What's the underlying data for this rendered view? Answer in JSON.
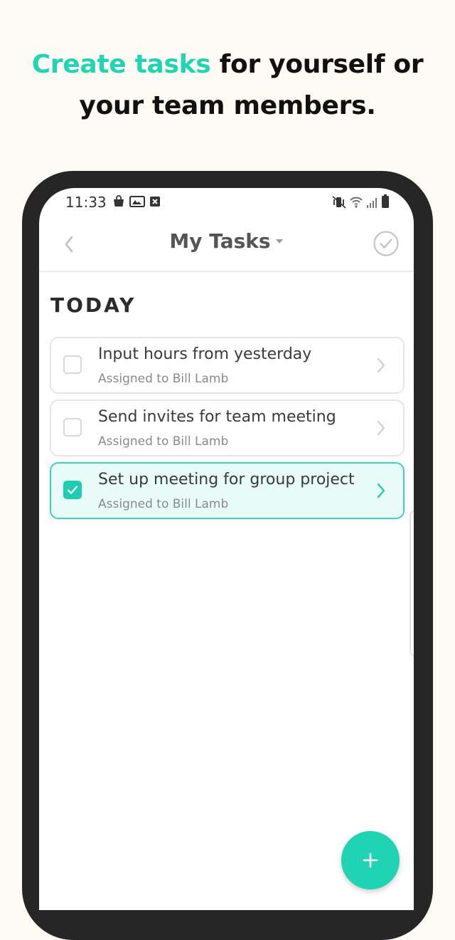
{
  "headline": {
    "accent": "Create tasks",
    "rest": " for yourself or your team members."
  },
  "status_bar": {
    "time": "11:33",
    "left_icons": [
      "shopping-bag-icon",
      "gallery-icon",
      "close-box-icon"
    ],
    "right_icons": [
      "vibrate-mute-icon",
      "wifi-icon",
      "signal-icon",
      "battery-icon"
    ]
  },
  "nav": {
    "title": "My Tasks",
    "back_icon": "chevron-left-icon",
    "title_icon": "caret-down-icon",
    "complete_icon": "check-circle-icon"
  },
  "section": {
    "title": "TODAY"
  },
  "tasks": [
    {
      "title": "Input hours from yesterday",
      "subtitle": "Assigned to Bill Lamb",
      "checked": false
    },
    {
      "title": "Send invites for team meeting",
      "subtitle": "Assigned to Bill Lamb",
      "checked": false
    },
    {
      "title": "Set up meeting for group project",
      "subtitle": "Assigned to Bill Lamb",
      "checked": true
    }
  ],
  "fab": {
    "icon": "plus-icon"
  },
  "colors": {
    "accent": "#22d3b4",
    "fab": "#1fd3b3",
    "checked_bg": "#e8fbf8",
    "background": "#fdfbf4",
    "phone_frame": "#262626"
  }
}
